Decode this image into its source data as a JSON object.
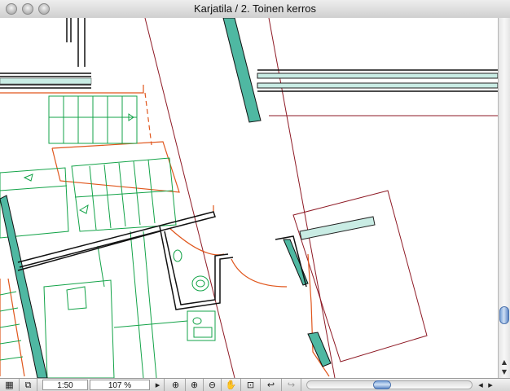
{
  "window": {
    "title": "Karjatila / 2. Toinen kerros"
  },
  "status": {
    "scale": "1:50",
    "zoom": "107 %"
  },
  "icons": {
    "layout": "layout-book-icon",
    "view": "view-window-icon",
    "next": "triangle-right-icon",
    "zoom_in_area": "zoom-area-icon",
    "zoom_in": "zoom-in-icon",
    "zoom_out": "zoom-out-icon",
    "pan": "hand-pan-icon",
    "fit": "fit-window-icon",
    "prev_zoom": "previous-zoom-icon",
    "next_zoom": "next-zoom-icon"
  },
  "colors": {
    "wall_fill": "#4fb8a2",
    "annotation_red": "#e0561c",
    "grid_dark_red": "#8e1a25",
    "fixture_green": "#13a348"
  }
}
